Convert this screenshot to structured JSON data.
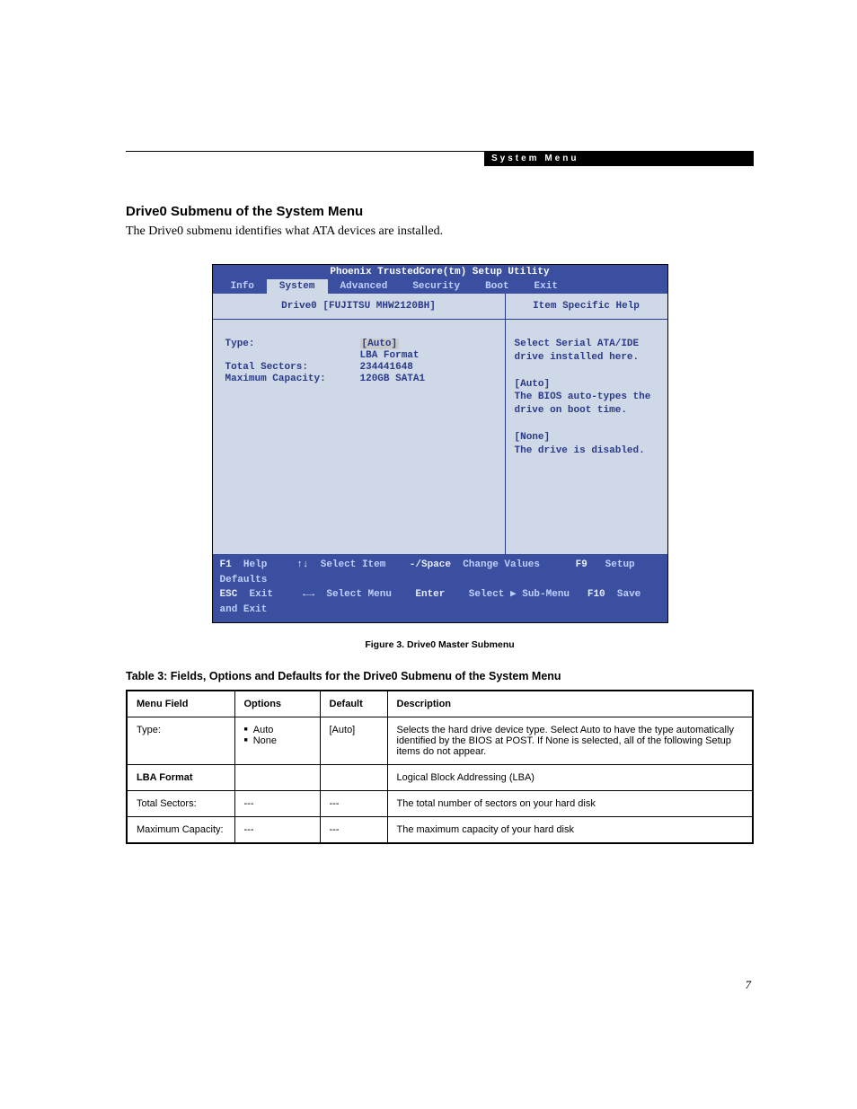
{
  "header": {
    "label": "System Menu"
  },
  "section": {
    "title": "Drive0 Submenu of the System Menu",
    "intro": "The Drive0 submenu identifies what ATA devices are installed."
  },
  "bios": {
    "title": "Phoenix TrustedCore(tm) Setup Utility",
    "tabs": [
      "Info",
      "System",
      "Advanced",
      "Security",
      "Boot",
      "Exit"
    ],
    "active_tab": 1,
    "left_title": "Drive0 [FUJITSU MHW2120BH]",
    "right_title": "Item Specific Help",
    "fields": {
      "type_label": "Type:",
      "type_value": "[Auto]",
      "lba_label": "LBA Format",
      "sectors_label": "Total Sectors:",
      "sectors_value": "234441648",
      "capacity_label": "Maximum Capacity:",
      "capacity_value": "120GB SATA1"
    },
    "help": {
      "l1": "Select Serial ATA/IDE",
      "l2": "drive installed here.",
      "l3": "[Auto]",
      "l4": "The BIOS auto-types the",
      "l5": "drive on boot time.",
      "l6": "[None]",
      "l7": "The drive is disabled."
    },
    "footer": {
      "f1": "F1",
      "help": "Help",
      "arrows_v": "↑↓",
      "select_item": "Select Item",
      "minus_space": "-/Space",
      "change_values": "Change Values",
      "f9": "F9",
      "setup_defaults": "Setup Defaults",
      "esc": "ESC",
      "exit": "Exit",
      "arrows_h": "←→",
      "select_menu": "Select Menu",
      "enter": "Enter",
      "select_sub": "Select ▶ Sub-Menu",
      "f10": "F10",
      "save_exit": "Save and Exit"
    }
  },
  "figure_caption": "Figure 3.  Drive0 Master Submenu",
  "table": {
    "title": "Table 3: Fields, Options and Defaults for the Drive0 Submenu of the System Menu",
    "headers": [
      "Menu Field",
      "Options",
      "Default",
      "Description"
    ],
    "rows": [
      {
        "field": "Type:",
        "options": [
          "Auto",
          "None"
        ],
        "default": "[Auto]",
        "desc": "Selects the hard drive device type. Select Auto to have the type automatically identified by the BIOS at POST. If None is selected, all of the following Setup items do not appear."
      },
      {
        "field": "LBA Format",
        "options_raw": "",
        "default": "",
        "desc": "Logical Block Addressing (LBA)",
        "lba": true
      },
      {
        "field": "Total Sectors:",
        "options_raw": "---",
        "default": "---",
        "desc": "The total number of sectors on your hard disk"
      },
      {
        "field": "Maximum Capacity:",
        "options_raw": "---",
        "default": "---",
        "desc": "The maximum capacity of your hard disk"
      }
    ]
  },
  "page_number": "7"
}
